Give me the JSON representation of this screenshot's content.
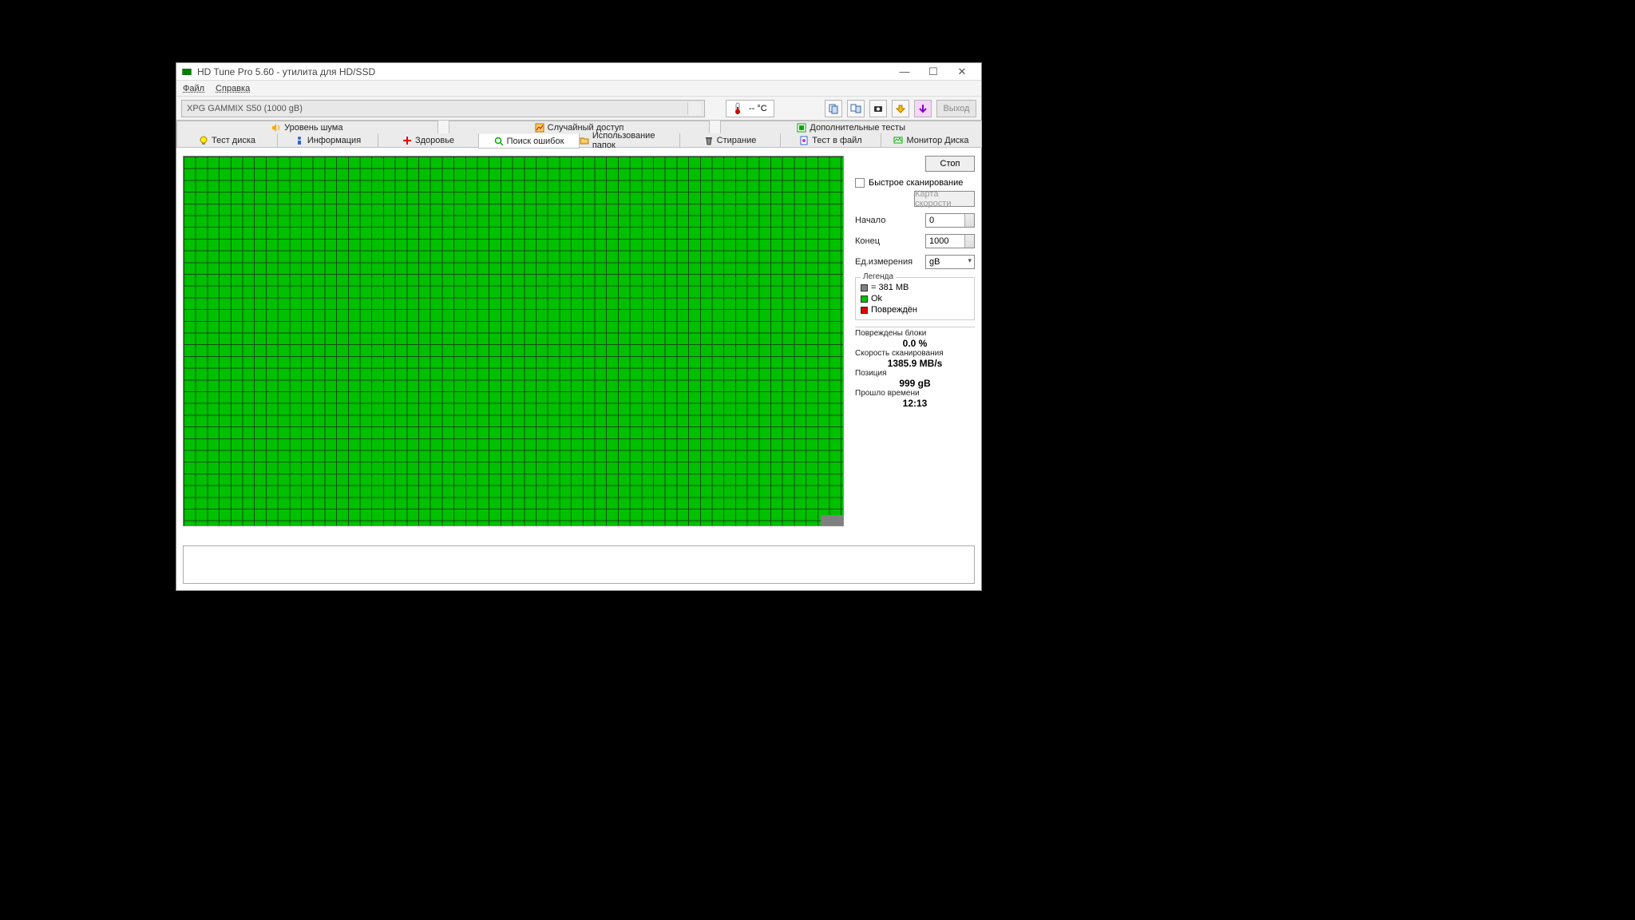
{
  "window": {
    "title": "HD Tune Pro 5.60 - утилита для HD/SSD"
  },
  "menu": {
    "file": "Файл",
    "help": "Справка"
  },
  "toolbar": {
    "drive": "XPG GAMMIX S50 (1000 gB)",
    "temp": "-- °C",
    "exit": "Выход"
  },
  "upper_tabs": [
    "Уровень шума",
    "Случайный доступ",
    "Дополнительные  тесты"
  ],
  "lower_tabs": [
    "Тест диска",
    "Информация",
    "Здоровье",
    "Поиск ошибок",
    "Использование папок",
    "Стирание",
    "Тест в файл",
    "Монитор Диска"
  ],
  "active_tab_index": 3,
  "side": {
    "stop": "Стоп",
    "quick": "Быстрое сканирование",
    "speedmap": "Карта скорости",
    "start_lbl": "Начало",
    "start_val": "0",
    "end_lbl": "Конец",
    "end_val": "1000",
    "unit_lbl": "Ед.измерения",
    "unit_val": "gB"
  },
  "legend": {
    "title": "Легенда",
    "block": "= 381 MB",
    "ok": "Ok",
    "bad": "Повреждён"
  },
  "stats": {
    "damaged_lbl": "Повреждены блоки",
    "damaged_val": "0.0 %",
    "speed_lbl": "Скорость сканирования",
    "speed_val": "1385.9 MB/s",
    "pos_lbl": "Позиция",
    "pos_val": "999 gB",
    "time_lbl": "Прошло времени",
    "time_val": "12:13"
  }
}
